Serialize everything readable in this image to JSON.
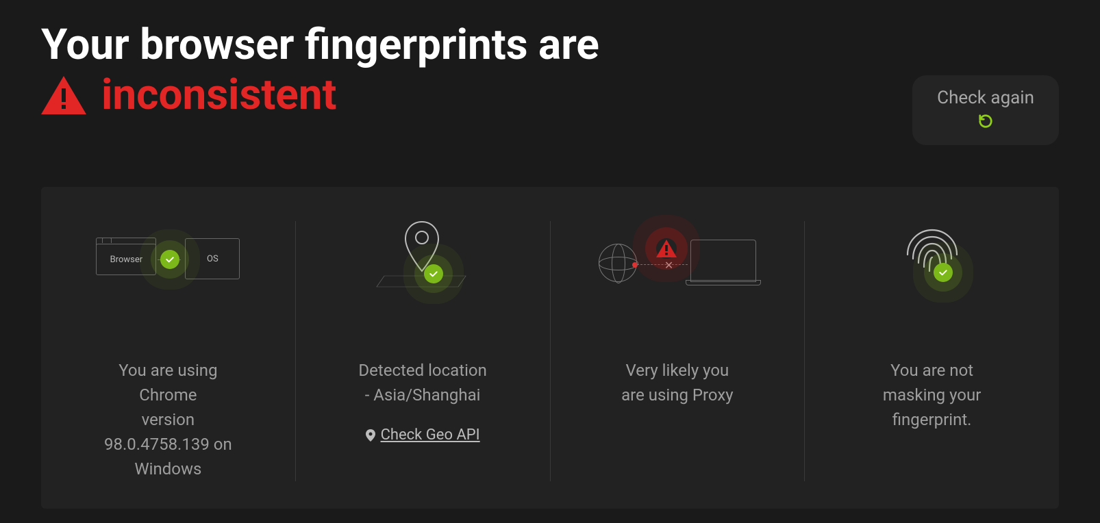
{
  "headline_prefix": "Your browser fingerprints are",
  "status_word": "inconsistent",
  "check_again_label": "Check again",
  "cards": {
    "browser_os": {
      "browser_label": "Browser",
      "os_label": "OS",
      "text": "You are using\nChrome\nversion\n98.0.4758.139 on\nWindows"
    },
    "location": {
      "text": "Detected location\n- Asia/Shanghai",
      "geo_link_label": "Check Geo API"
    },
    "proxy": {
      "text": "Very likely you\nare using Proxy"
    },
    "fingerprint": {
      "text": "You are not\nmasking your\nfingerprint."
    }
  },
  "colors": {
    "danger": "#e22626",
    "success": "#7db81a",
    "bg": "#1a1a1a",
    "panel": "#222222"
  }
}
